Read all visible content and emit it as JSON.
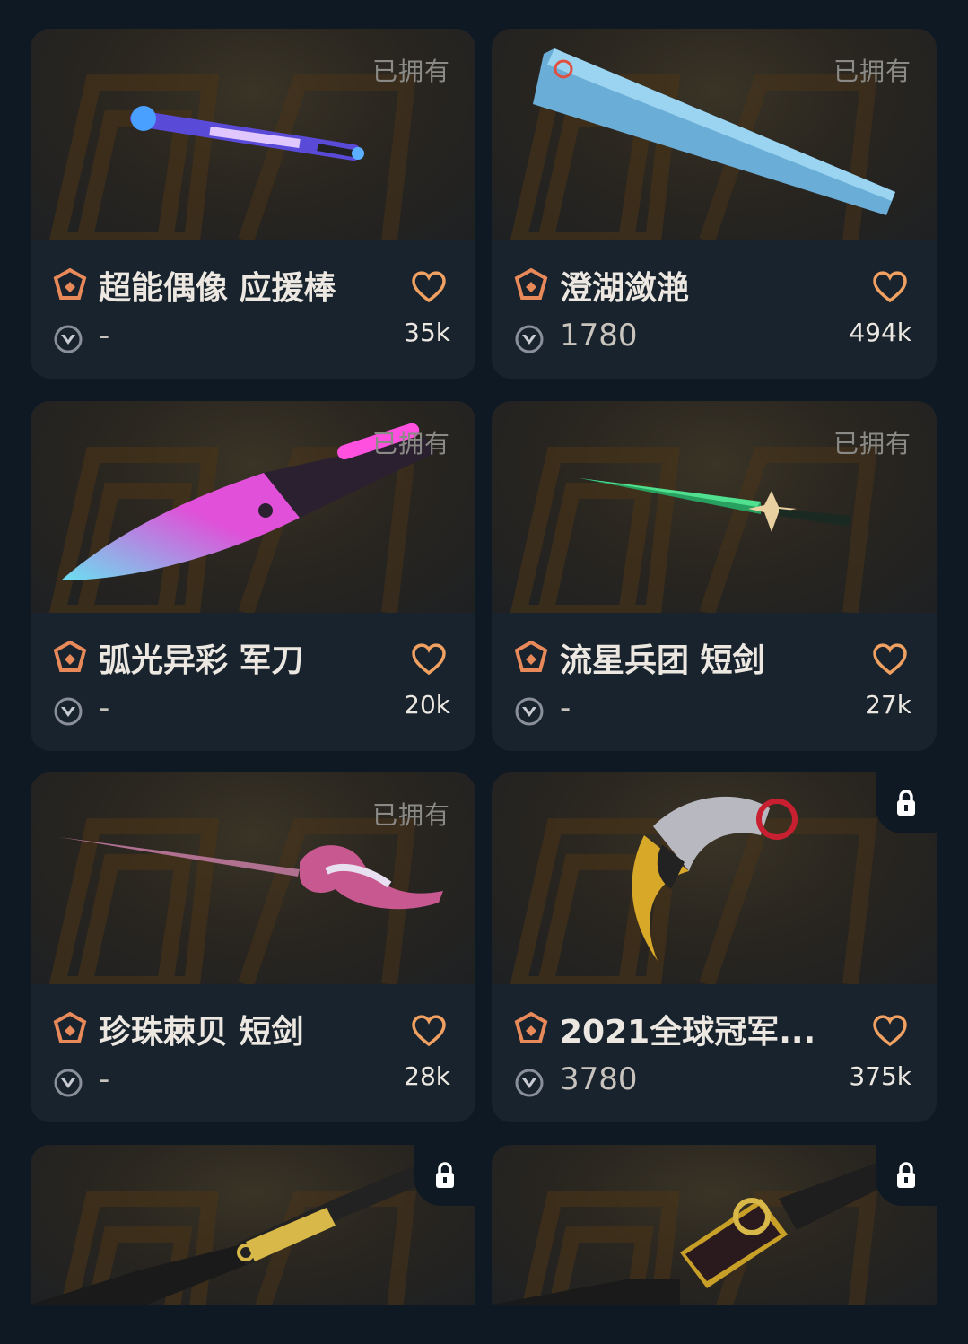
{
  "owned_label": "已拥有",
  "items": [
    {
      "name": "超能偶像 应援棒",
      "price": "-",
      "likes": "35k",
      "owned": true,
      "locked": false,
      "weapon_icon": "melee-baton"
    },
    {
      "name": "澄湖潋滟",
      "price": "1780",
      "likes": "494k",
      "owned": true,
      "locked": false,
      "weapon_icon": "melee-fan"
    },
    {
      "name": "弧光异彩 军刀",
      "price": "-",
      "likes": "20k",
      "owned": true,
      "locked": false,
      "weapon_icon": "melee-knife"
    },
    {
      "name": "流星兵团 短剑",
      "price": "-",
      "likes": "27k",
      "owned": true,
      "locked": false,
      "weapon_icon": "melee-dagger"
    },
    {
      "name": "珍珠棘贝 短剑",
      "price": "-",
      "likes": "28k",
      "owned": true,
      "locked": false,
      "weapon_icon": "melee-rapier"
    },
    {
      "name": "2021全球冠军...",
      "price": "3780",
      "likes": "375k",
      "owned": false,
      "locked": true,
      "weapon_icon": "melee-karambit"
    },
    {
      "name": "",
      "price": "",
      "likes": "",
      "owned": false,
      "locked": true,
      "weapon_icon": "melee-butterfly"
    },
    {
      "name": "",
      "price": "",
      "likes": "",
      "owned": false,
      "locked": true,
      "weapon_icon": "melee-kunai"
    }
  ],
  "colors": {
    "background": "#0f1923",
    "card": "#18232d",
    "tier_icon": "#e8895a",
    "heart": "#f0a060"
  }
}
